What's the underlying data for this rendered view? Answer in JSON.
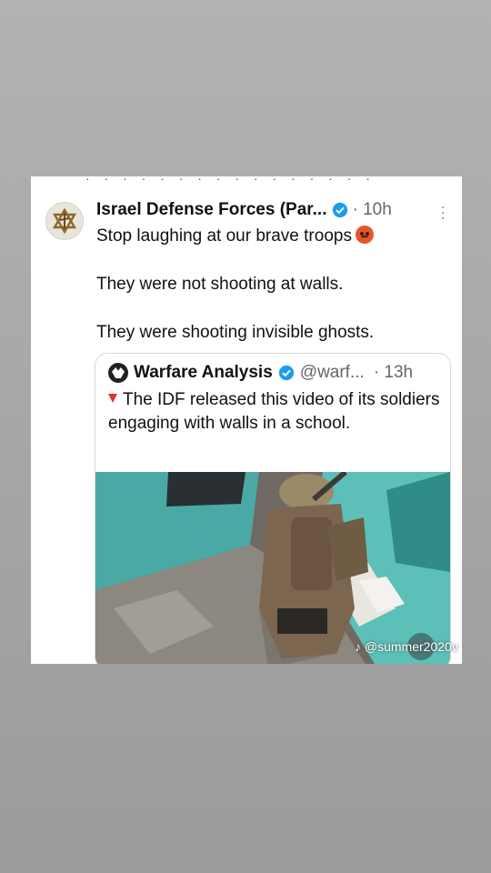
{
  "post": {
    "author": "Israel Defense Forces (Par...",
    "time": "· 10h",
    "lines": [
      "Stop laughing at our brave troops",
      "They were not shooting at walls.",
      "They were shooting invisible ghosts."
    ],
    "emoji": "angry-face-emoji",
    "more_icon": "more-vertical-icon",
    "avatar_icon": "idf-emblem-icon"
  },
  "quote": {
    "author": "Warfare Analysis",
    "handle": "@warf...",
    "time": "· 13h",
    "text": "The IDF released this video of its soldiers engaging with walls in a school.",
    "bullet_icon": "red-triangle-down-icon"
  },
  "watermark": "@summer2020v",
  "colors": {
    "verified_blue": "#1d9bf0",
    "emoji": "#e8552e",
    "red_triangle": "#e0322b",
    "wall_teal": "#4fb9b3"
  }
}
